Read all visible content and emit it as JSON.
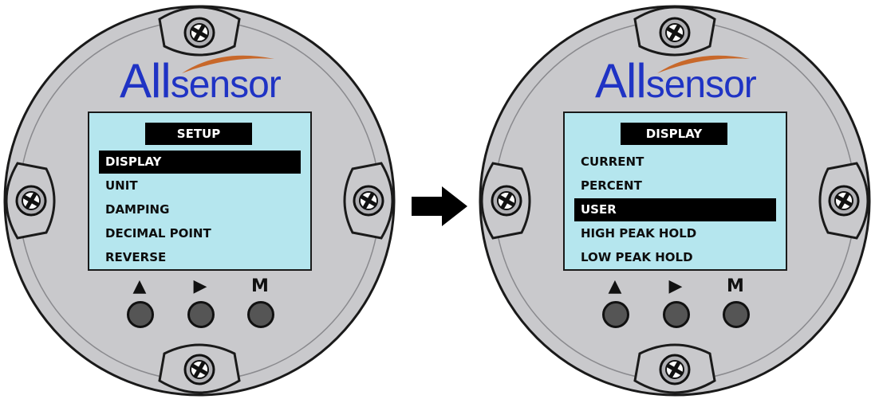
{
  "brand": {
    "name_part1": "All",
    "name_part2": "sensor"
  },
  "colors": {
    "housing": "#c9c9cc",
    "screen": "#b5e6ee",
    "brand_blue": "#1f33c4",
    "swoosh": "#c8682a"
  },
  "devices": [
    {
      "screen_title": "SETUP",
      "menu": [
        "DISPLAY",
        "UNIT",
        "DAMPING",
        "DECIMAL POINT",
        "REVERSE"
      ],
      "selected_index": 0,
      "buttons": {
        "up": "▲",
        "right": "▶",
        "mode": "M"
      }
    },
    {
      "screen_title": "DISPLAY",
      "menu": [
        "CURRENT",
        "PERCENT",
        "USER",
        "HIGH PEAK HOLD",
        "LOW PEAK HOLD"
      ],
      "selected_index": 2,
      "buttons": {
        "up": "▲",
        "right": "▶",
        "mode": "M"
      }
    }
  ],
  "transition_icon": "right-arrow-icon"
}
